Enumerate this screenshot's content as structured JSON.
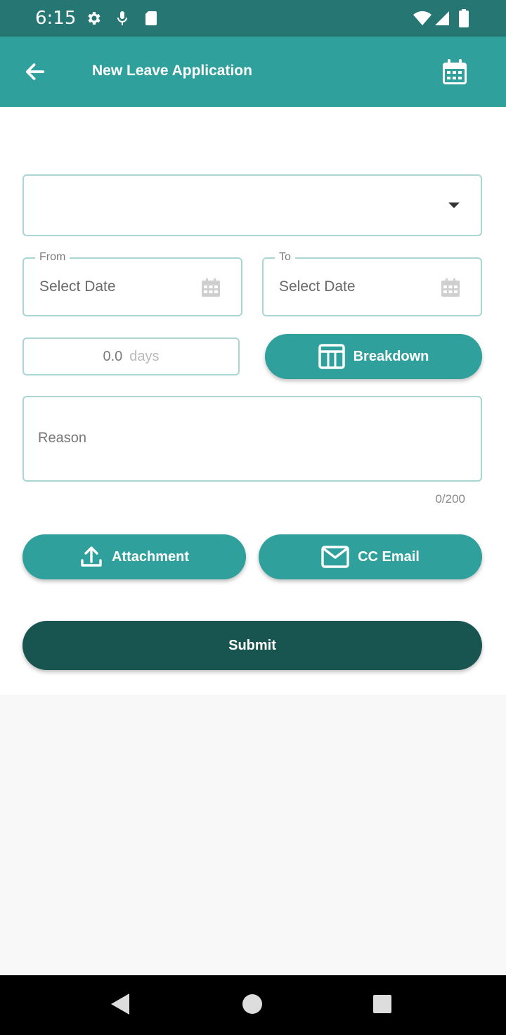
{
  "status_bar": {
    "time": "6:15",
    "left_icons": [
      "gear-icon",
      "mic-icon",
      "sd-card-icon"
    ],
    "right_icons": [
      "wifi-icon",
      "signal-icon",
      "battery-icon"
    ]
  },
  "app_bar": {
    "title": "New Leave Application",
    "back_icon": "arrow-left-icon",
    "action_icon": "calendar-icon"
  },
  "form": {
    "leave_type": {
      "value": ""
    },
    "from": {
      "label": "From",
      "placeholder": "Select Date"
    },
    "to": {
      "label": "To",
      "placeholder": "Select Date"
    },
    "days": {
      "value": "0.0",
      "unit": "days"
    },
    "breakdown_label": "Breakdown",
    "reason": {
      "placeholder": "Reason",
      "counter": "0/200"
    },
    "attachment_label": "Attachment",
    "cc_email_label": "CC Email",
    "submit_label": "Submit"
  },
  "colors": {
    "status_bar": "#267774",
    "app_bar": "#30a09c",
    "primary_button": "#30a09c",
    "submit_button": "#195550",
    "field_border": "#a9d6d3"
  },
  "nav_bar": {
    "buttons": [
      "back-triangle-icon",
      "home-circle-icon",
      "recents-square-icon"
    ]
  }
}
